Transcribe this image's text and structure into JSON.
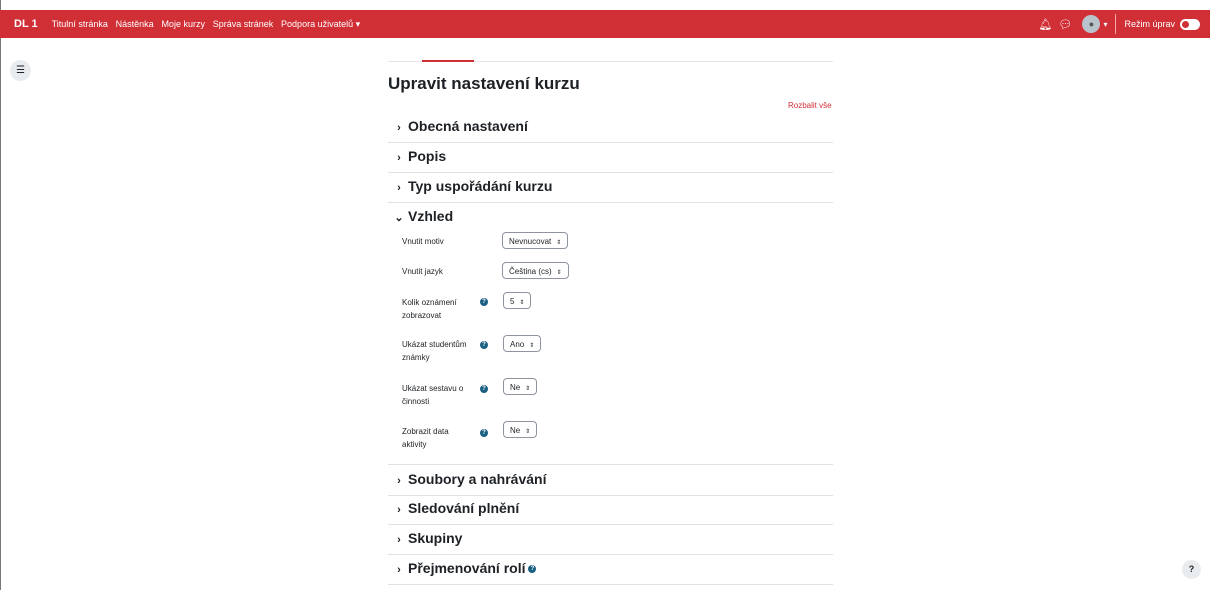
{
  "brand_color": "#d12f36",
  "topbar": {
    "site_name": "DL 1",
    "nav": [
      "Titulní stránka",
      "Nástěnka",
      "Moje kurzy",
      "Správa stránek",
      "Podpora uživatelů"
    ],
    "edit_mode_label": "Režim úprav"
  },
  "page": {
    "title": "Upravit nastavení kurzu",
    "expand_all": "Rozbalit vše"
  },
  "sections": {
    "general": "Obecná nastavení",
    "description": "Popis",
    "format": "Typ uspořádání kurzu",
    "appearance": "Vzhled",
    "files": "Soubory a nahrávání",
    "completion": "Sledování plnění",
    "groups": "Skupiny",
    "roles": "Přejmenování rolí"
  },
  "appearance_fields": {
    "theme_label": "Vnutit motiv",
    "theme_value": "Nevnucovat",
    "lang_label": "Vnutit jazyk",
    "lang_value": "Čeština (cs)",
    "news_label": "Kolik oznámení zobrazovat",
    "news_value": "5",
    "grades_label": "Ukázat studentům známky",
    "grades_value": "Ano",
    "reports_label": "Ukázat sestavu o činnosti",
    "reports_value": "Ne",
    "dates_label": "Zobrazit data aktivity",
    "dates_value": "Ne"
  },
  "icons": {
    "notifications": "bell-icon",
    "messages": "chat-icon",
    "drawer": "list-icon",
    "help": "question-icon"
  },
  "help_float": "?"
}
